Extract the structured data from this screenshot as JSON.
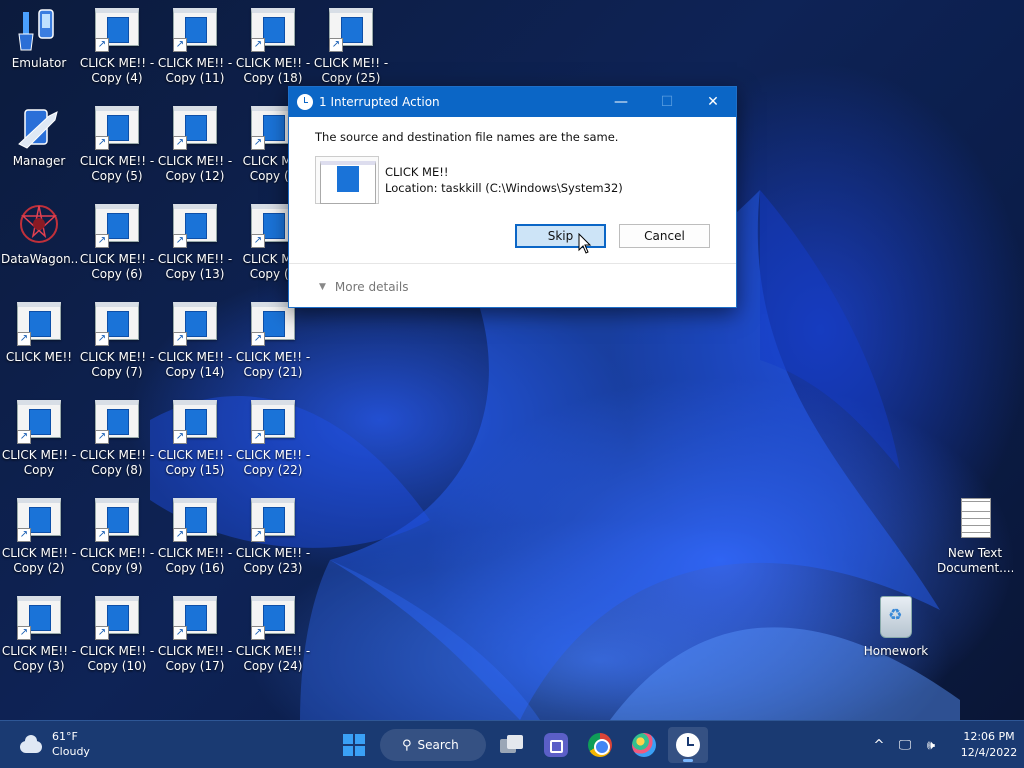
{
  "desktop": {
    "icons": [
      {
        "label": "Emulator"
      },
      {
        "label": "Manager"
      },
      {
        "label": "DataWagon..."
      },
      {
        "label": "CLICK ME!!"
      },
      {
        "label": "CLICK ME!! - Copy"
      },
      {
        "label": "CLICK ME!! - Copy (2)"
      },
      {
        "label": "CLICK ME!! - Copy (3)"
      },
      {
        "label": "CLICK ME!! - Copy (4)"
      },
      {
        "label": "CLICK ME!! - Copy (5)"
      },
      {
        "label": "CLICK ME!! - Copy (6)"
      },
      {
        "label": "CLICK ME!! - Copy (7)"
      },
      {
        "label": "CLICK ME!! - Copy (8)"
      },
      {
        "label": "CLICK ME!! - Copy (9)"
      },
      {
        "label": "CLICK ME!! - Copy (10)"
      },
      {
        "label": "CLICK ME!! - Copy (11)"
      },
      {
        "label": "CLICK ME!! - Copy (12)"
      },
      {
        "label": "CLICK ME!! - Copy (13)"
      },
      {
        "label": "CLICK ME!! - Copy (14)"
      },
      {
        "label": "CLICK ME!! - Copy (15)"
      },
      {
        "label": "CLICK ME!! - Copy (16)"
      },
      {
        "label": "CLICK ME!! - Copy (17)"
      },
      {
        "label": "CLICK ME!! - Copy (18)"
      },
      {
        "label": "CLICK MI - Copy (1"
      },
      {
        "label": "CLICK MI - Copy (2"
      },
      {
        "label": "CLICK ME!! - Copy (21)"
      },
      {
        "label": "CLICK ME!! - Copy (22)"
      },
      {
        "label": "CLICK ME!! - Copy (23)"
      },
      {
        "label": "CLICK ME!! - Copy (24)"
      },
      {
        "label": "CLICK ME!! - Copy (25)"
      },
      {
        "label": "New Text Document...."
      },
      {
        "label": "Homework"
      }
    ]
  },
  "dialog": {
    "title": "1 Interrupted Action",
    "minimize": "—",
    "maximize": "☐",
    "close": "✕",
    "message": "The source and destination file names are the same.",
    "file_name": "CLICK ME!!",
    "file_location": "Location: taskkill (C:\\Windows\\System32)",
    "skip_label": "Skip",
    "cancel_label": "Cancel",
    "more_details_label": "More details"
  },
  "taskbar": {
    "weather_temp": "61°F",
    "weather_desc": "Cloudy",
    "search_label": "Search",
    "tray_chevron": "^",
    "time": "12:06 PM",
    "date": "12/4/2022"
  },
  "colors": {
    "accent": "#0b66c6",
    "taskbar": "#1a3a72"
  }
}
